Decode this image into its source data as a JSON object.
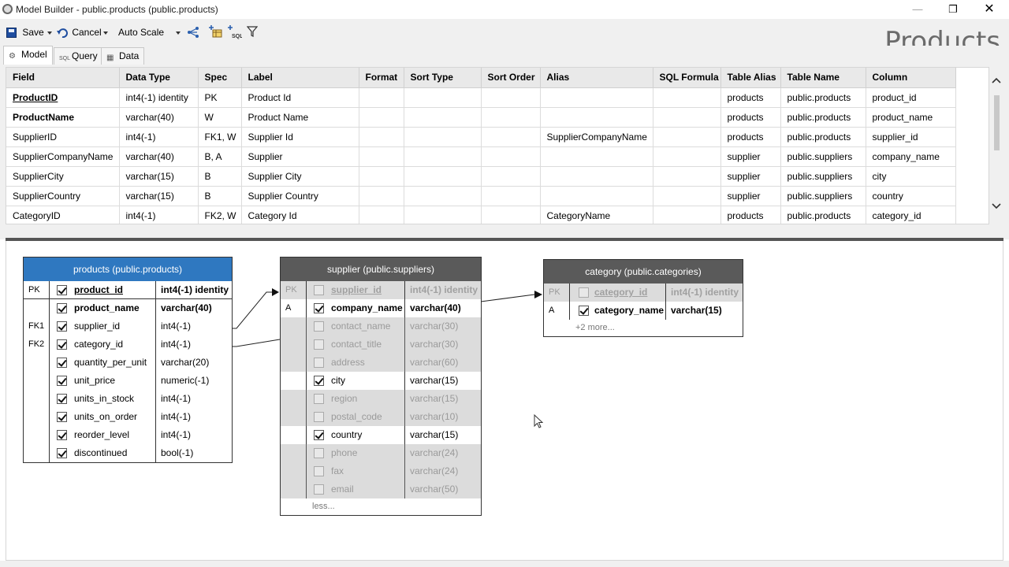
{
  "window": {
    "title": "Model Builder - public.products (public.products)",
    "minimize": "—",
    "restore": "❐",
    "close": "✕"
  },
  "toolbar": {
    "save_label": "Save",
    "cancel_label": "Cancel",
    "autoscale_label": "Auto Scale"
  },
  "heading": "Products",
  "tabs": [
    {
      "label": "Model",
      "active": true
    },
    {
      "label": "Query",
      "active": false
    },
    {
      "label": "Data",
      "active": false
    }
  ],
  "grid": {
    "columns": [
      "Field",
      "Data Type",
      "Spec",
      "Label",
      "Format",
      "Sort Type",
      "Sort Order",
      "Alias",
      "SQL Formula",
      "Table Alias",
      "Table Name",
      "Column"
    ],
    "rows": [
      [
        "ProductID",
        "int4(-1) identity",
        "PK",
        "Product Id",
        "",
        "",
        "",
        "",
        "",
        "products",
        "public.products",
        "product_id"
      ],
      [
        "ProductName",
        "varchar(40)",
        "W",
        "Product Name",
        "",
        "",
        "",
        "",
        "",
        "products",
        "public.products",
        "product_name"
      ],
      [
        "SupplierID",
        "int4(-1)",
        "FK1, W",
        "Supplier Id",
        "",
        "",
        "",
        "SupplierCompanyName",
        "",
        "products",
        "public.products",
        "supplier_id"
      ],
      [
        "SupplierCompanyName",
        "varchar(40)",
        "B, A",
        "Supplier",
        "",
        "",
        "",
        "",
        "",
        "supplier",
        "public.suppliers",
        "company_name"
      ],
      [
        "SupplierCity",
        "varchar(15)",
        "B",
        "Supplier City",
        "",
        "",
        "",
        "",
        "",
        "supplier",
        "public.suppliers",
        "city"
      ],
      [
        "SupplierCountry",
        "varchar(15)",
        "B",
        "Supplier Country",
        "",
        "",
        "",
        "",
        "",
        "supplier",
        "public.suppliers",
        "country"
      ],
      [
        "CategoryID",
        "int4(-1)",
        "FK2, W",
        "Category Id",
        "",
        "",
        "",
        "CategoryName",
        "",
        "products",
        "public.products",
        "category_id"
      ]
    ]
  },
  "entities": {
    "products": {
      "title": "products (public.products)",
      "header_color": "#2f78c0",
      "fields": [
        {
          "key": "PK",
          "name": "product_id",
          "type": "int4(-1) identity",
          "checked": true,
          "style": "pk"
        },
        {
          "key": "",
          "name": "product_name",
          "type": "varchar(40)",
          "checked": true,
          "style": "bold"
        },
        {
          "key": "FK1",
          "name": "supplier_id",
          "type": "int4(-1)",
          "checked": true,
          "style": ""
        },
        {
          "key": "FK2",
          "name": "category_id",
          "type": "int4(-1)",
          "checked": true,
          "style": ""
        },
        {
          "key": "",
          "name": "quantity_per_unit",
          "type": "varchar(20)",
          "checked": true,
          "style": ""
        },
        {
          "key": "",
          "name": "unit_price",
          "type": "numeric(-1)",
          "checked": true,
          "style": ""
        },
        {
          "key": "",
          "name": "units_in_stock",
          "type": "int4(-1)",
          "checked": true,
          "style": ""
        },
        {
          "key": "",
          "name": "units_on_order",
          "type": "int4(-1)",
          "checked": true,
          "style": ""
        },
        {
          "key": "",
          "name": "reorder_level",
          "type": "int4(-1)",
          "checked": true,
          "style": ""
        },
        {
          "key": "",
          "name": "discontinued",
          "type": "bool(-1)",
          "checked": true,
          "style": ""
        }
      ]
    },
    "supplier": {
      "title": "supplier (public.suppliers)",
      "header_color": "#5a5a5a",
      "fields": [
        {
          "key": "PK",
          "name": "supplier_id",
          "type": "int4(-1) identity",
          "checked": false,
          "style": "dimpk"
        },
        {
          "key": "A",
          "name": "company_name",
          "type": "varchar(40)",
          "checked": true,
          "style": "bold sel"
        },
        {
          "key": "",
          "name": "contact_name",
          "type": "varchar(30)",
          "checked": false,
          "style": "dim"
        },
        {
          "key": "",
          "name": "contact_title",
          "type": "varchar(30)",
          "checked": false,
          "style": "dim"
        },
        {
          "key": "",
          "name": "address",
          "type": "varchar(60)",
          "checked": false,
          "style": "dim"
        },
        {
          "key": "",
          "name": "city",
          "type": "varchar(15)",
          "checked": true,
          "style": "sel"
        },
        {
          "key": "",
          "name": "region",
          "type": "varchar(15)",
          "checked": false,
          "style": "dim"
        },
        {
          "key": "",
          "name": "postal_code",
          "type": "varchar(10)",
          "checked": false,
          "style": "dim"
        },
        {
          "key": "",
          "name": "country",
          "type": "varchar(15)",
          "checked": true,
          "style": "sel"
        },
        {
          "key": "",
          "name": "phone",
          "type": "varchar(24)",
          "checked": false,
          "style": "dim"
        },
        {
          "key": "",
          "name": "fax",
          "type": "varchar(24)",
          "checked": false,
          "style": "dim"
        },
        {
          "key": "",
          "name": "email",
          "type": "varchar(50)",
          "checked": false,
          "style": "dim"
        }
      ],
      "footer": "less..."
    },
    "category": {
      "title": "category (public.categories)",
      "header_color": "#5a5a5a",
      "fields": [
        {
          "key": "PK",
          "name": "category_id",
          "type": "int4(-1) identity",
          "checked": false,
          "style": "dimpk"
        },
        {
          "key": "A",
          "name": "category_name",
          "type": "varchar(15)",
          "checked": true,
          "style": "bold sel"
        }
      ],
      "footer": "+2 more..."
    }
  }
}
